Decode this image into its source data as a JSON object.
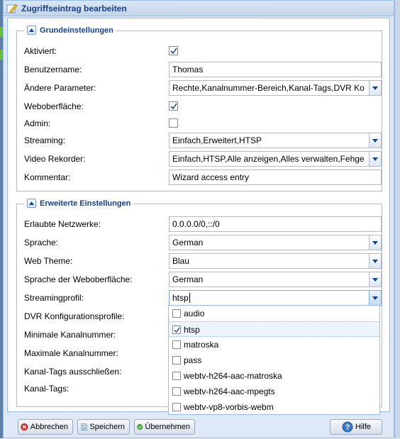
{
  "window": {
    "title": "Zugriffseintrag bearbeiten"
  },
  "basic": {
    "legend": "Grundeinstellungen",
    "enabled": {
      "label": "Aktiviert:",
      "checked": true
    },
    "username": {
      "label": "Benutzername:",
      "value": "Thomas"
    },
    "change": {
      "label": "Ändere Parameter:",
      "value": "Rechte,Kanalnummer-Bereich,Kanal-Tags,DVR Ko"
    },
    "webui": {
      "label": "Weboberfläche:",
      "checked": true
    },
    "admin": {
      "label": "Admin:",
      "checked": false
    },
    "streaming": {
      "label": "Streaming:",
      "value": "Einfach,Erweitert,HTSP"
    },
    "dvr": {
      "label": "Video Rekorder:",
      "value": "Einfach,HTSP,Alle anzeigen,Alles verwalten,Fehge"
    },
    "comment": {
      "label": "Kommentar:",
      "value": "Wizard access entry"
    }
  },
  "advanced": {
    "legend": "Erweiterte Einstellungen",
    "prefix": {
      "label": "Erlaubte Netzwerke:",
      "value": "0.0.0.0/0,::/0"
    },
    "lang": {
      "label": "Sprache:",
      "value": "German"
    },
    "theme": {
      "label": "Web Theme:",
      "value": "Blau"
    },
    "langui": {
      "label": "Sprache der Weboberfläche:",
      "value": "German"
    },
    "profile": {
      "label": "Streamingprofil:",
      "value": "htsp"
    },
    "dvr_config": {
      "label": "DVR Konfigurationsprofile:"
    },
    "channel_min": {
      "label": "Minimale Kanalnummer:"
    },
    "channel_max": {
      "label": "Maximale Kanalnummer:"
    },
    "channel_tag_exclude": {
      "label": "Kanal-Tags ausschließen:"
    },
    "channel_tag": {
      "label": "Kanal-Tags:"
    }
  },
  "profile_dropdown": {
    "options": [
      {
        "label": "audio",
        "checked": false
      },
      {
        "label": "htsp",
        "checked": true
      },
      {
        "label": "matroska",
        "checked": false
      },
      {
        "label": "pass",
        "checked": false
      },
      {
        "label": "webtv-h264-aac-matroska",
        "checked": false
      },
      {
        "label": "webtv-h264-aac-mpegts",
        "checked": false
      },
      {
        "label": "webtv-vp8-vorbis-webm",
        "checked": false
      }
    ]
  },
  "buttons": {
    "cancel": "Abbrechen",
    "save": "Speichern",
    "apply": "Übernehmen",
    "help": "Hilfe"
  },
  "colors": {
    "header_text": "#15428b",
    "border": "#99bbe8",
    "background": "#dfe8f6"
  },
  "icons": {
    "title": "edit-pencil-icon",
    "cancel": "cancel-icon",
    "save": "save-icon",
    "apply": "apply-check-icon",
    "help": "help-icon"
  }
}
